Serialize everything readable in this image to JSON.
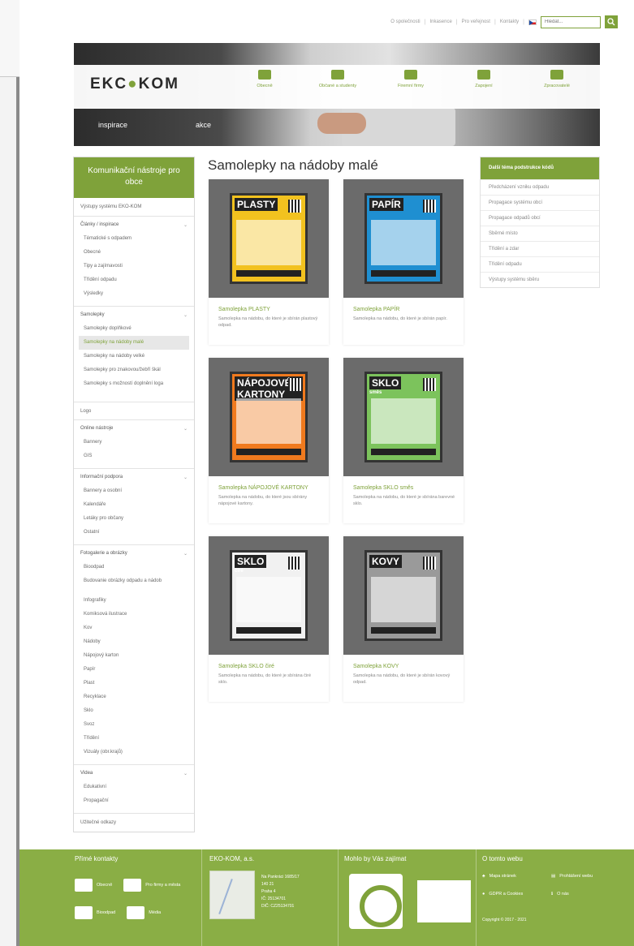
{
  "util_bar": {
    "links": [
      "O společnosti",
      "Inkasence",
      "Pro veřejnost",
      "Kontakty"
    ],
    "search_placeholder": "Hledat..."
  },
  "brand": {
    "logo_left": "EKC",
    "logo_right": "KOM"
  },
  "hero": {
    "label_left": "inspirace",
    "label_right": "akce"
  },
  "main_nav": [
    {
      "label": "Obecně",
      "icon": "handshake-icon"
    },
    {
      "label": "Občané a studenty",
      "icon": "family-icon"
    },
    {
      "label": "Firemní firmy",
      "icon": "truck-icon"
    },
    {
      "label": "Zapojení",
      "icon": "building-icon"
    },
    {
      "label": "Zpracovatelé",
      "icon": "factory-icon"
    }
  ],
  "sidebar": {
    "header": "Komunikační nástroje pro obce",
    "top_item": "Výstupy systému EKO-KOM",
    "groups": [
      {
        "title": "Články / inspirace",
        "items": [
          "Tématické s odpadem",
          "Obecné",
          "Tipy a zajímavosti",
          "Třídění odpadu",
          "Výsledky"
        ]
      },
      {
        "title": "Samolepky",
        "items": [
          "Samolepky doplňkové",
          "Samolepky na nádoby malé",
          "Samolepky na nádoby velké",
          "Samolepky pro znakovou/žebří škál",
          "Samolepky s možností doplnění loga"
        ],
        "active_index": 1,
        "wrap_index": 4
      }
    ],
    "single_logo": "Logo",
    "groups2": [
      {
        "title": "Online nástroje",
        "items": [
          "Bannery",
          "GIS"
        ]
      },
      {
        "title": "Informační podpora",
        "items": [
          "Bannery a osobní",
          "Kalendáře",
          "Letáky pro občany",
          "Ostatní"
        ]
      },
      {
        "title": "Fotogalerie a obrázky",
        "items": [
          "Bioodpad",
          "Budovanie obrázky odpadu a nádob",
          "Infografiky",
          "Komiksová ilustrace",
          "Kov",
          "Nádoby",
          "Nápojový karton",
          "Papír",
          "Plast",
          "Recyklace",
          "Sklo",
          "Svoz",
          "Třídění",
          "Vizuály (obr.krajů)"
        ]
      },
      {
        "title": "Videa",
        "items": [
          "Edukativní",
          "Propagační"
        ]
      }
    ],
    "bottom_item": "Užitečné odkazy"
  },
  "page": {
    "title": "Samolepky na nádoby malé"
  },
  "cards": [
    {
      "poster_word": "PLASTY",
      "poster_sub": "",
      "poster_bg": "#f2c21f",
      "title": "Samolepka PLASTY",
      "desc": "Samolepka na nádobu, do které je sbírán plastový odpad."
    },
    {
      "poster_word": "PAPÍR",
      "poster_sub": "",
      "poster_bg": "#1f8fd1",
      "title": "Samolepka PAPÍR",
      "desc": "Samolepka na nádobu, do které je sbírán papír."
    },
    {
      "poster_word": "NÁPOJOVÉ KARTONY",
      "poster_sub": "",
      "poster_bg": "#f07a1e",
      "title": "Samolepka NÁPOJOVÉ KARTONY",
      "desc": "Samolepka na nádobu, do které jsou sbírány nápojové kartony."
    },
    {
      "poster_word": "SKLO",
      "poster_sub": "směs",
      "poster_bg": "#7cc35c",
      "title": "Samolepka SKLO směs",
      "desc": "Samolepka na nádobu, do které je sbírána barevné sklo."
    },
    {
      "poster_word": "SKLO",
      "poster_sub": "čiré",
      "poster_bg": "#f1f1f1",
      "title": "Samolepka SKLO čiré",
      "desc": "Samolepka na nádobu, do které je sbírána čiré sklo."
    },
    {
      "poster_word": "KOVY",
      "poster_sub": "",
      "poster_bg": "#9a9a9a",
      "title": "Samolepka KOVY",
      "desc": "Samolepka na nádobu, do které je sbírán kovový odpad."
    }
  ],
  "right_box": {
    "header": "Další téma podstrukce kódů",
    "items": [
      "Předcházení vzniku odpadu",
      "Propagace systému obcí",
      "Propagace odpadů obcí",
      "Sběrné místo",
      "Třídění a zdar",
      "Třídění odpadu",
      "Výstupy systému sběru"
    ]
  },
  "footer": {
    "col1": {
      "head": "Přímé kontakty",
      "a": "Obecně",
      "b": "Pro firmy a města",
      "c": "Bioodpad",
      "d": "Média"
    },
    "col2": {
      "head": "EKO-KOM, a.s.",
      "lines": [
        "Na Pankráci 1685/17",
        "140 21",
        "Praha 4",
        "IČ: 25134701",
        "DIČ: CZ25134701"
      ]
    },
    "col3": {
      "head": "Mohlo by Vás zajímat"
    },
    "col4": {
      "head": "O tomto webu",
      "a": "Mapa stránek",
      "b": "Prohlášení webu",
      "c": "GDPR a Cookies",
      "d": "O nás",
      "copy": "Copyright © 2017 - 2021"
    }
  },
  "colors": {
    "accent": "#7fa23a",
    "footer": "#8aae45",
    "thumb_bg": "#6b6b6b"
  }
}
